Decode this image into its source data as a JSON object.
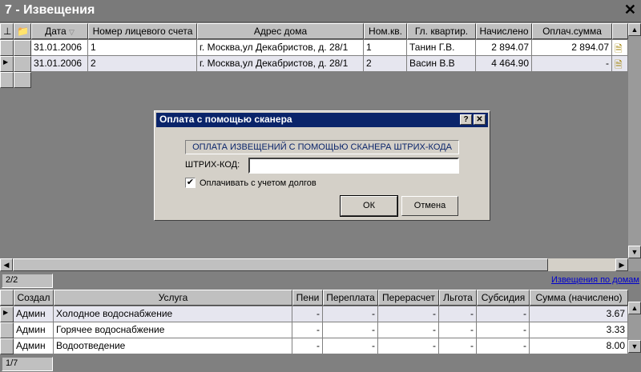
{
  "window": {
    "title": "7 - Извещения",
    "close": "✕"
  },
  "grid": {
    "columns": [
      "Дата",
      "Номер лицевого счета",
      "Адрес дома",
      "Ном.кв.",
      "Гл. квартир.",
      "Начислено",
      "Оплач.сумма"
    ],
    "rows": [
      {
        "date": "31.01.2006",
        "account": "1",
        "address": "г. Москва,ул Декабристов, д. 28/1",
        "flat": "1",
        "owner": "Танин Г.В.",
        "charged": "2 894.07",
        "paid": "2 894.07"
      },
      {
        "date": "31.01.2006",
        "account": "2",
        "address": "г. Москва,ул Декабристов, д. 28/1",
        "flat": "2",
        "owner": "Васин В.В",
        "charged": "4 464.90",
        "paid": "-"
      }
    ],
    "status": "2/2",
    "link": "Извещения по домам"
  },
  "services": {
    "columns": [
      "Создал",
      "Услуга",
      "Пени",
      "Переплата",
      "Перерасчет",
      "Льгота",
      "Субсидия",
      "Сумма (начислено)"
    ],
    "rows": [
      {
        "creator": "Админ",
        "service": "Холодное водоснабжение",
        "peni": "-",
        "over": "-",
        "recalc": "-",
        "benefit": "-",
        "subsidy": "-",
        "sum": "3.67"
      },
      {
        "creator": "Админ",
        "service": "Горячее водоснабжение",
        "peni": "-",
        "over": "-",
        "recalc": "-",
        "benefit": "-",
        "subsidy": "-",
        "sum": "3.33"
      },
      {
        "creator": "Админ",
        "service": "Водоотведение",
        "peni": "-",
        "over": "-",
        "recalc": "-",
        "benefit": "-",
        "subsidy": "-",
        "sum": "8.00"
      }
    ],
    "status": "1/7"
  },
  "dialog": {
    "title": "Оплата с помощью сканера",
    "help": "?",
    "close": "✕",
    "caption": "ОПЛАТА ИЗВЕЩЕНИЙ С ПОМОЩЬЮ СКАНЕРА ШТРИХ-КОДА",
    "barcode_label": "ШТРИХ-КОД:",
    "barcode_value": "",
    "checkbox_label": "Оплачивать с учетом долгов",
    "checkbox_checked": true,
    "ok": "ОК",
    "cancel": "Отмена"
  }
}
